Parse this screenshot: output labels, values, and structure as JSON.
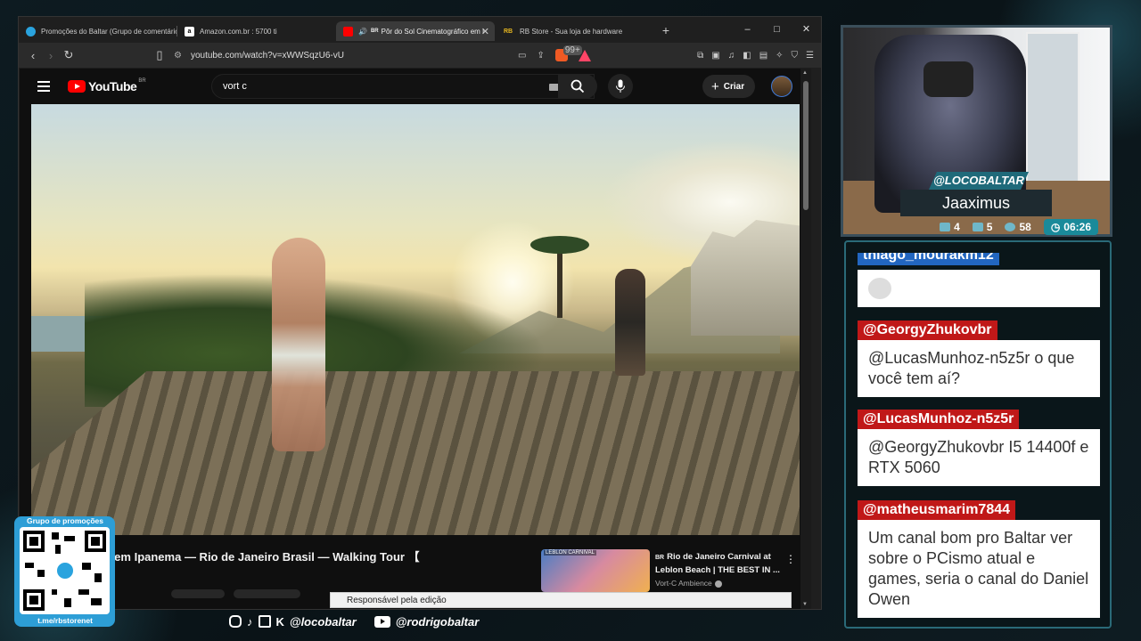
{
  "browser": {
    "tabs": [
      {
        "title": "Promoções do Baltar (Grupo de comentário",
        "favicon": "telegram-icon",
        "color": "#2aa3de"
      },
      {
        "title": "Amazon.com.br : 5700 ti",
        "favicon": "amazon-icon",
        "color": "#ffffff"
      },
      {
        "title": "Pôr do Sol Cinematográfico em I",
        "favicon": "youtube-icon",
        "color": "#ff0000",
        "prefix": "BR"
      },
      {
        "title": "RB Store - Sua loja de hardware",
        "favicon": "rb-store-icon",
        "color": "#e8b820",
        "prefix": "RB"
      }
    ],
    "url": "youtube.com/watch?v=xWWSqzU6-vU",
    "brave_badge": "99+",
    "window_controls": [
      "–",
      "□",
      "✕"
    ]
  },
  "youtube": {
    "logo": "YouTube",
    "region": "BR",
    "search_value": "vort c",
    "create_label": "Criar",
    "video_title": "nematográfico em Ipanema — Rio de Janeiro Brasil — Walking Tour 【",
    "recommendation": {
      "thumb_label": "LEBLON CARNIVAL",
      "badge": "BR",
      "title": "Rio de Janeiro Carnival at Leblon Beach | THE BEST IN ...",
      "channel": "Vort-C Ambience"
    }
  },
  "status_bar": "Responsável pela edição",
  "webcam": {
    "handle": "@LOCOBALTAR",
    "name": "Jaaximus",
    "stats": {
      "chat": "4",
      "youtube": "5",
      "viewers": "58",
      "timer": "06:26"
    }
  },
  "chat": [
    {
      "user": "thiago_mourakm12",
      "color": "blue",
      "body": "🐭"
    },
    {
      "user": "@GeorgyZhukovbr",
      "color": "red",
      "body": "@LucasMunhoz-n5z5r o que você tem aí?"
    },
    {
      "user": "@LucasMunhoz-n5z5r",
      "color": "red",
      "body": "@GeorgyZhukovbr I5 14400f e RTX 5060"
    },
    {
      "user": "@matheusmarim7844",
      "color": "red",
      "body": "Um canal bom pro Baltar ver sobre o PCismo atual e games, seria o canal do Daniel Owen"
    }
  ],
  "promo": {
    "title": "Grupo de promoções",
    "url": "t.me/rbstorenet"
  },
  "socials": {
    "instagram_tiktok_twitch_kick": "@locobaltar",
    "youtube": "@rodrigobaltar"
  }
}
